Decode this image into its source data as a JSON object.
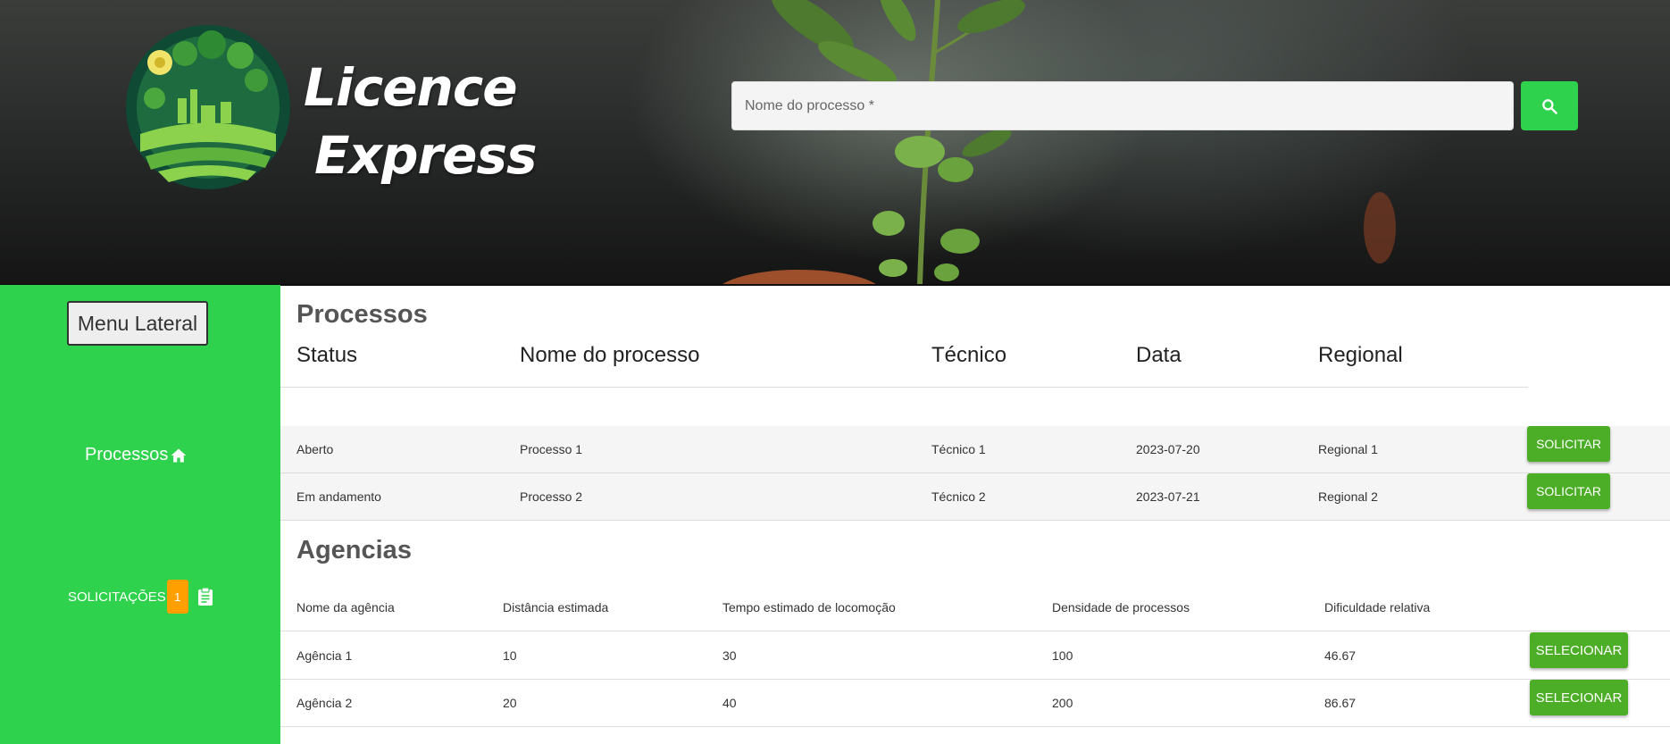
{
  "header": {
    "brand_line1": "Licence",
    "brand_line2": "Express",
    "search_placeholder": "Nome do processo *",
    "accent": "#2fd24c"
  },
  "sidebar": {
    "menu_label": "Menu Lateral",
    "processos_label": "Processos",
    "solicitacoes_label": "SOLICITAÇÕES",
    "solicitacoes_count": "1",
    "background": "#2fd24c",
    "badge_color": "#ffa000"
  },
  "processos": {
    "title": "Processos",
    "columns": [
      "Status",
      "Nome do processo",
      "Técnico",
      "Data",
      "Regional"
    ],
    "rows": [
      [
        "Aberto",
        "Processo 1",
        "Técnico 1",
        "2023-07-20",
        "Regional 1"
      ],
      [
        "Em andamento",
        "Processo 2",
        "Técnico 2",
        "2023-07-21",
        "Regional 2"
      ]
    ],
    "action_label": "SOLICITAR"
  },
  "agencias": {
    "title": "Agencias",
    "columns": [
      "Nome da agência",
      "Distância estimada",
      "Tempo estimado de locomoção",
      "Densidade de processos",
      "Dificuldade relativa"
    ],
    "rows": [
      [
        "Agência 1",
        "10",
        "30",
        "100",
        "46.67"
      ],
      [
        "Agência 2",
        "20",
        "40",
        "200",
        "86.67"
      ]
    ],
    "action_label": "SELECIONAR"
  },
  "icons": {
    "search": "search-icon",
    "home": "home-icon",
    "clipboard": "clipboard-icon"
  }
}
